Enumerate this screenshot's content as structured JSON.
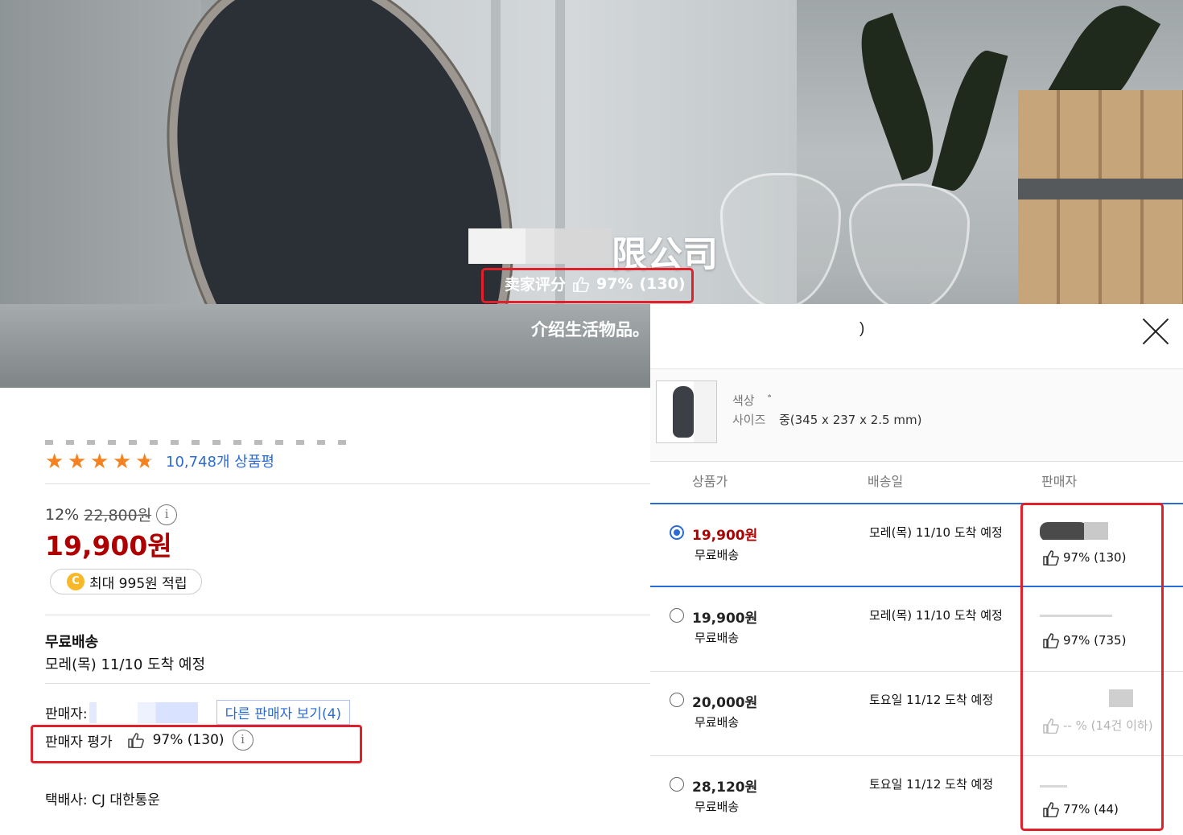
{
  "banner": {
    "shop_name_suffix": "限公司",
    "seller_score_label": "卖家评分",
    "seller_score_value": "97%",
    "seller_score_count": "(130)",
    "intro": "介绍生活物品。"
  },
  "product": {
    "review_count_label": "10,748개 상품평",
    "rating_stars": 4.5,
    "discount": "12%",
    "original_price": "22,800원",
    "sale_price": "19,900원",
    "points_badge": "C",
    "points_text": "최대 995원 적립",
    "shipping_title": "무료배송",
    "shipping_date": "모레(목) 11/10 도착 예정",
    "seller_label": "판매자:",
    "other_sellers_button": "다른 판매자 보기(4)",
    "seller_rating_label": "판매자 평가",
    "seller_rating_value": "97% (130)",
    "courier": "택배사: CJ 대한통운"
  },
  "popup": {
    "title": ")",
    "option_color_label": "색상",
    "option_color_value": "ﾞ",
    "option_size_label": "사이즈",
    "option_size_value": "중(345 x 237 x 2.5 mm)",
    "columns": [
      "상품가",
      "배송일",
      "판매자"
    ],
    "offers": [
      {
        "price": "19,900원",
        "shipping": "무료배송",
        "date": "모레(목) 11/10 도착 예정",
        "rating": "97% (130)",
        "selected": true
      },
      {
        "price": "19,900원",
        "shipping": "무료배송",
        "date": "모레(목) 11/10 도착 예정",
        "rating": "97% (735)",
        "selected": false
      },
      {
        "price": "20,000원",
        "shipping": "무료배송",
        "date": "토요일 11/12 도착 예정",
        "rating": "-- % (14건 이하)",
        "selected": false
      },
      {
        "price": "28,120원",
        "shipping": "무료배송",
        "date": "토요일 11/12 도착 예정",
        "rating": "77% (44)",
        "selected": false
      }
    ]
  },
  "colors": {
    "highlight": "#e0212b",
    "price_red": "#ae0000",
    "link_blue": "#2b6bd7",
    "star_orange": "#f58220"
  },
  "icons": [
    "thumbs-up-icon",
    "info-icon",
    "close-icon",
    "star-icon",
    "radio-icon",
    "coin-icon"
  ]
}
